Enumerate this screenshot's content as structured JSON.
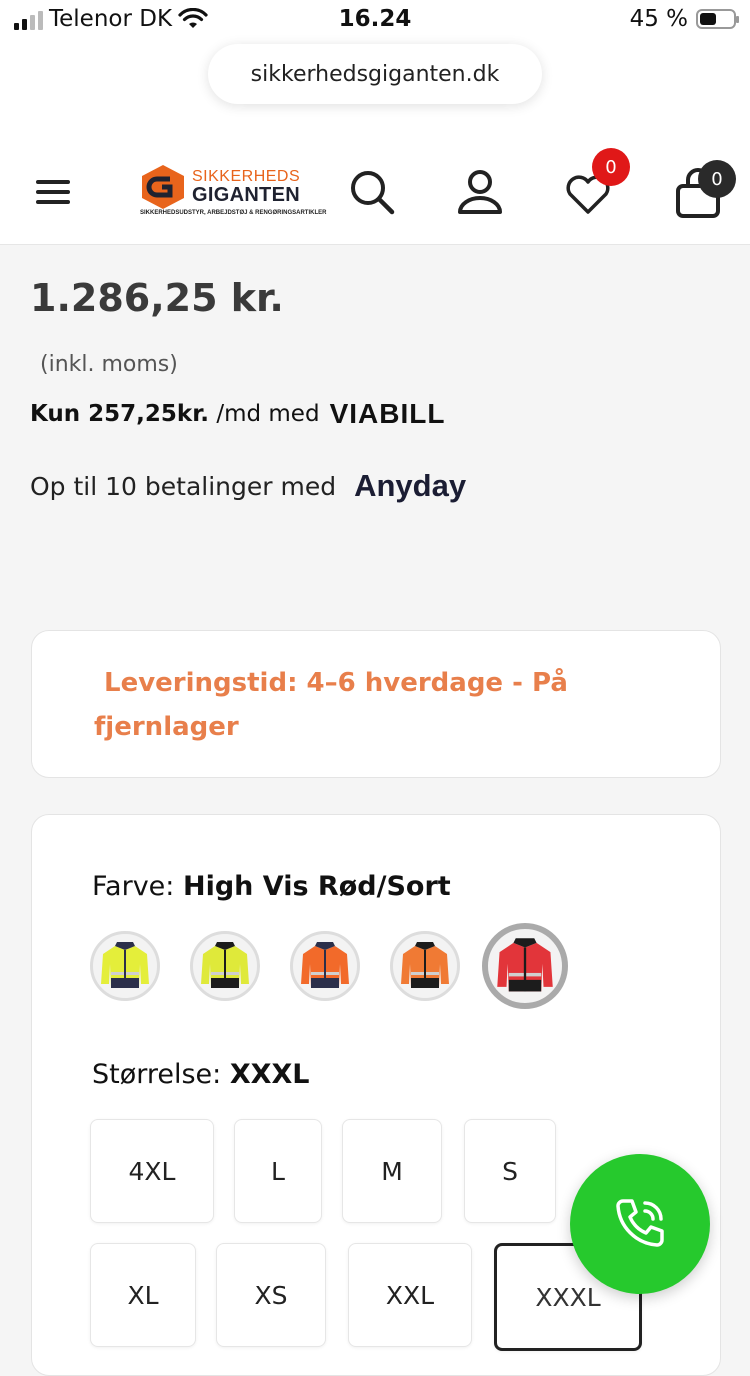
{
  "status_bar": {
    "carrier": "Telenor DK",
    "time": "16.24",
    "battery": "45 %"
  },
  "browser": {
    "url": "sikkerhedsgiganten.dk"
  },
  "header": {
    "logo": {
      "line1": "SIKKERHEDS",
      "line2": "GIGANTEN",
      "tagline": "SIKKERHEDSUDSTYR, ARBEJDSTØJ & RENGØRINGSARTIKLER"
    },
    "wishlist_count": "0",
    "cart_count": "0"
  },
  "product": {
    "price": "1.286,25 kr.",
    "vat_note": "(inkl. moms)",
    "viabill": {
      "amount": "Kun 257,25kr.",
      "suffix": " /md med",
      "brand": "VIABILL"
    },
    "anyday": {
      "text": "Op til 10 betalinger med",
      "brand": "Anyday"
    },
    "delivery": "Leveringstid: 4–6 hverdage - På fjernlager",
    "color": {
      "label": "Farve:",
      "value": "High Vis Rød/Sort"
    },
    "swatches": [
      {
        "name": "high-vis-yellow-navy",
        "body": "#e4ee3a",
        "trim": "#2b2f4a"
      },
      {
        "name": "high-vis-yellow-black",
        "body": "#dfe93a",
        "trim": "#1c1c1c"
      },
      {
        "name": "high-vis-orange-navy",
        "body": "#f26a2a",
        "trim": "#2b2f4a"
      },
      {
        "name": "high-vis-orange-black",
        "body": "#f07a34",
        "trim": "#1c1c1c"
      },
      {
        "name": "high-vis-red-black",
        "body": "#e2353a",
        "trim": "#1c1c1c"
      }
    ],
    "size": {
      "label": "Størrelse:",
      "value": "XXXL"
    },
    "sizes": [
      "4XL",
      "L",
      "M",
      "S",
      "XL",
      "XS",
      "XXL",
      "XXXL"
    ]
  },
  "colors": {
    "accent_orange": "#e87f4b",
    "call_green": "#26c92d",
    "badge_red": "#e01818"
  }
}
